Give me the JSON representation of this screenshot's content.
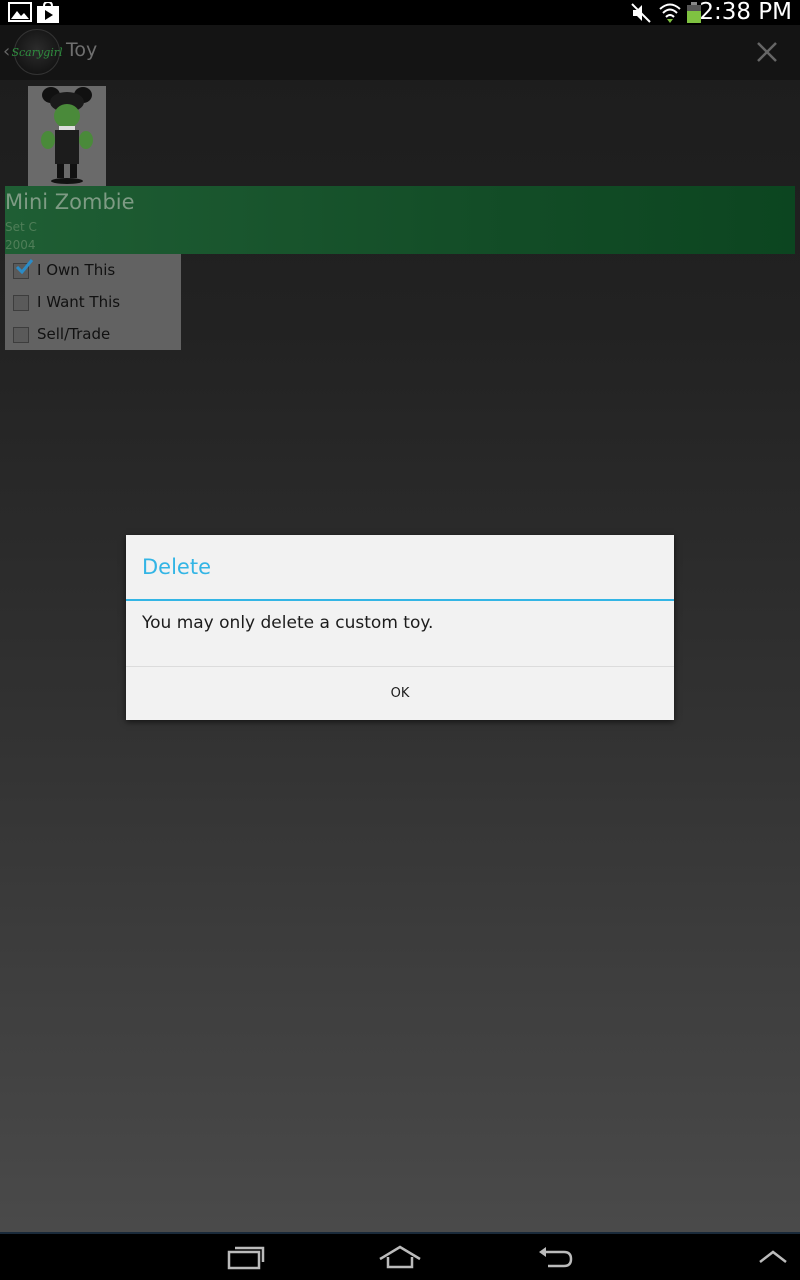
{
  "status_bar": {
    "time": "2:38 PM",
    "left_icons": [
      "gallery-icon",
      "play-store-icon"
    ],
    "right_icons": [
      "mute-icon",
      "wifi-icon",
      "battery-icon"
    ]
  },
  "action_bar": {
    "logo_text": "Scarygirl",
    "title": "Toy"
  },
  "toy": {
    "name": "Mini Zombie",
    "set": "Set C",
    "year": "2004"
  },
  "checkboxes": [
    {
      "label": "I Own This",
      "checked": true
    },
    {
      "label": "I Want This",
      "checked": false
    },
    {
      "label": "Sell/Trade",
      "checked": false
    }
  ],
  "dialog": {
    "title": "Delete",
    "message": "You may only delete a custom toy.",
    "ok_label": "OK"
  },
  "colors": {
    "accent": "#33b5e5",
    "banner_green": "#134d27"
  },
  "nav_bar": {
    "icons": [
      "recent-apps-icon",
      "home-icon",
      "back-icon",
      "chevron-up-icon"
    ]
  }
}
